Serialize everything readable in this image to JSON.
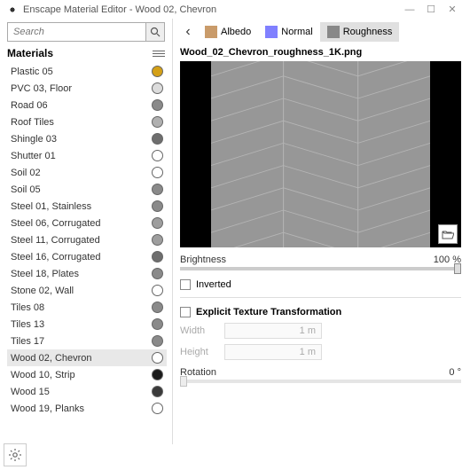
{
  "window": {
    "title": "Enscape Material Editor - Wood 02, Chevron"
  },
  "search": {
    "placeholder": "Search"
  },
  "materials_header": "Materials",
  "materials": [
    {
      "label": "Plastic 05",
      "color": "#d4a017",
      "selected": false
    },
    {
      "label": "PVC 03, Floor",
      "color": "#dcdcdc",
      "selected": false
    },
    {
      "label": "Road 06",
      "color": "#8a8a8a",
      "selected": false
    },
    {
      "label": "Roof Tiles",
      "color": "#b0b0b0",
      "selected": false
    },
    {
      "label": "Shingle 03",
      "color": "#6e6e6e",
      "selected": false
    },
    {
      "label": "Shutter 01",
      "color": "#ffffff",
      "selected": false
    },
    {
      "label": "Soil 02",
      "color": "#ffffff",
      "selected": false
    },
    {
      "label": "Soil 05",
      "color": "#8a8a8a",
      "selected": false
    },
    {
      "label": "Steel 01, Stainless",
      "color": "#8a8a8a",
      "selected": false
    },
    {
      "label": "Steel 06, Corrugated",
      "color": "#9e9e9e",
      "selected": false
    },
    {
      "label": "Steel 11, Corrugated",
      "color": "#9e9e9e",
      "selected": false
    },
    {
      "label": "Steel 16, Corrugated",
      "color": "#6e6e6e",
      "selected": false
    },
    {
      "label": "Steel 18, Plates",
      "color": "#8a8a8a",
      "selected": false
    },
    {
      "label": "Stone 02, Wall",
      "color": "#ffffff",
      "selected": false
    },
    {
      "label": "Tiles 08",
      "color": "#8a8a8a",
      "selected": false
    },
    {
      "label": "Tiles 13",
      "color": "#8a8a8a",
      "selected": false
    },
    {
      "label": "Tiles 17",
      "color": "#8a8a8a",
      "selected": false
    },
    {
      "label": "Wood 02, Chevron",
      "color": "#ffffff",
      "selected": true
    },
    {
      "label": "Wood 10, Strip",
      "color": "#1a1a1a",
      "selected": false
    },
    {
      "label": "Wood 15",
      "color": "#3a3a3a",
      "selected": false
    },
    {
      "label": "Wood 19, Planks",
      "color": "#ffffff",
      "selected": false
    }
  ],
  "tabs": {
    "back": "‹",
    "items": [
      {
        "label": "Albedo",
        "color": "#c99b6a",
        "active": false
      },
      {
        "label": "Normal",
        "color": "#8080ff",
        "active": false
      },
      {
        "label": "Roughness",
        "color": "#888888",
        "active": true
      }
    ]
  },
  "texture": {
    "filename": "Wood_02_Chevron_roughness_1K.png"
  },
  "brightness": {
    "label": "Brightness",
    "value": "100",
    "unit": "%"
  },
  "inverted": {
    "label": "Inverted",
    "checked": false
  },
  "explicit": {
    "label": "Explicit Texture Transformation",
    "checked": false
  },
  "width": {
    "label": "Width",
    "value": "1 m"
  },
  "height": {
    "label": "Height",
    "value": "1 m"
  },
  "rotation": {
    "label": "Rotation",
    "value": "0",
    "unit": "°"
  }
}
